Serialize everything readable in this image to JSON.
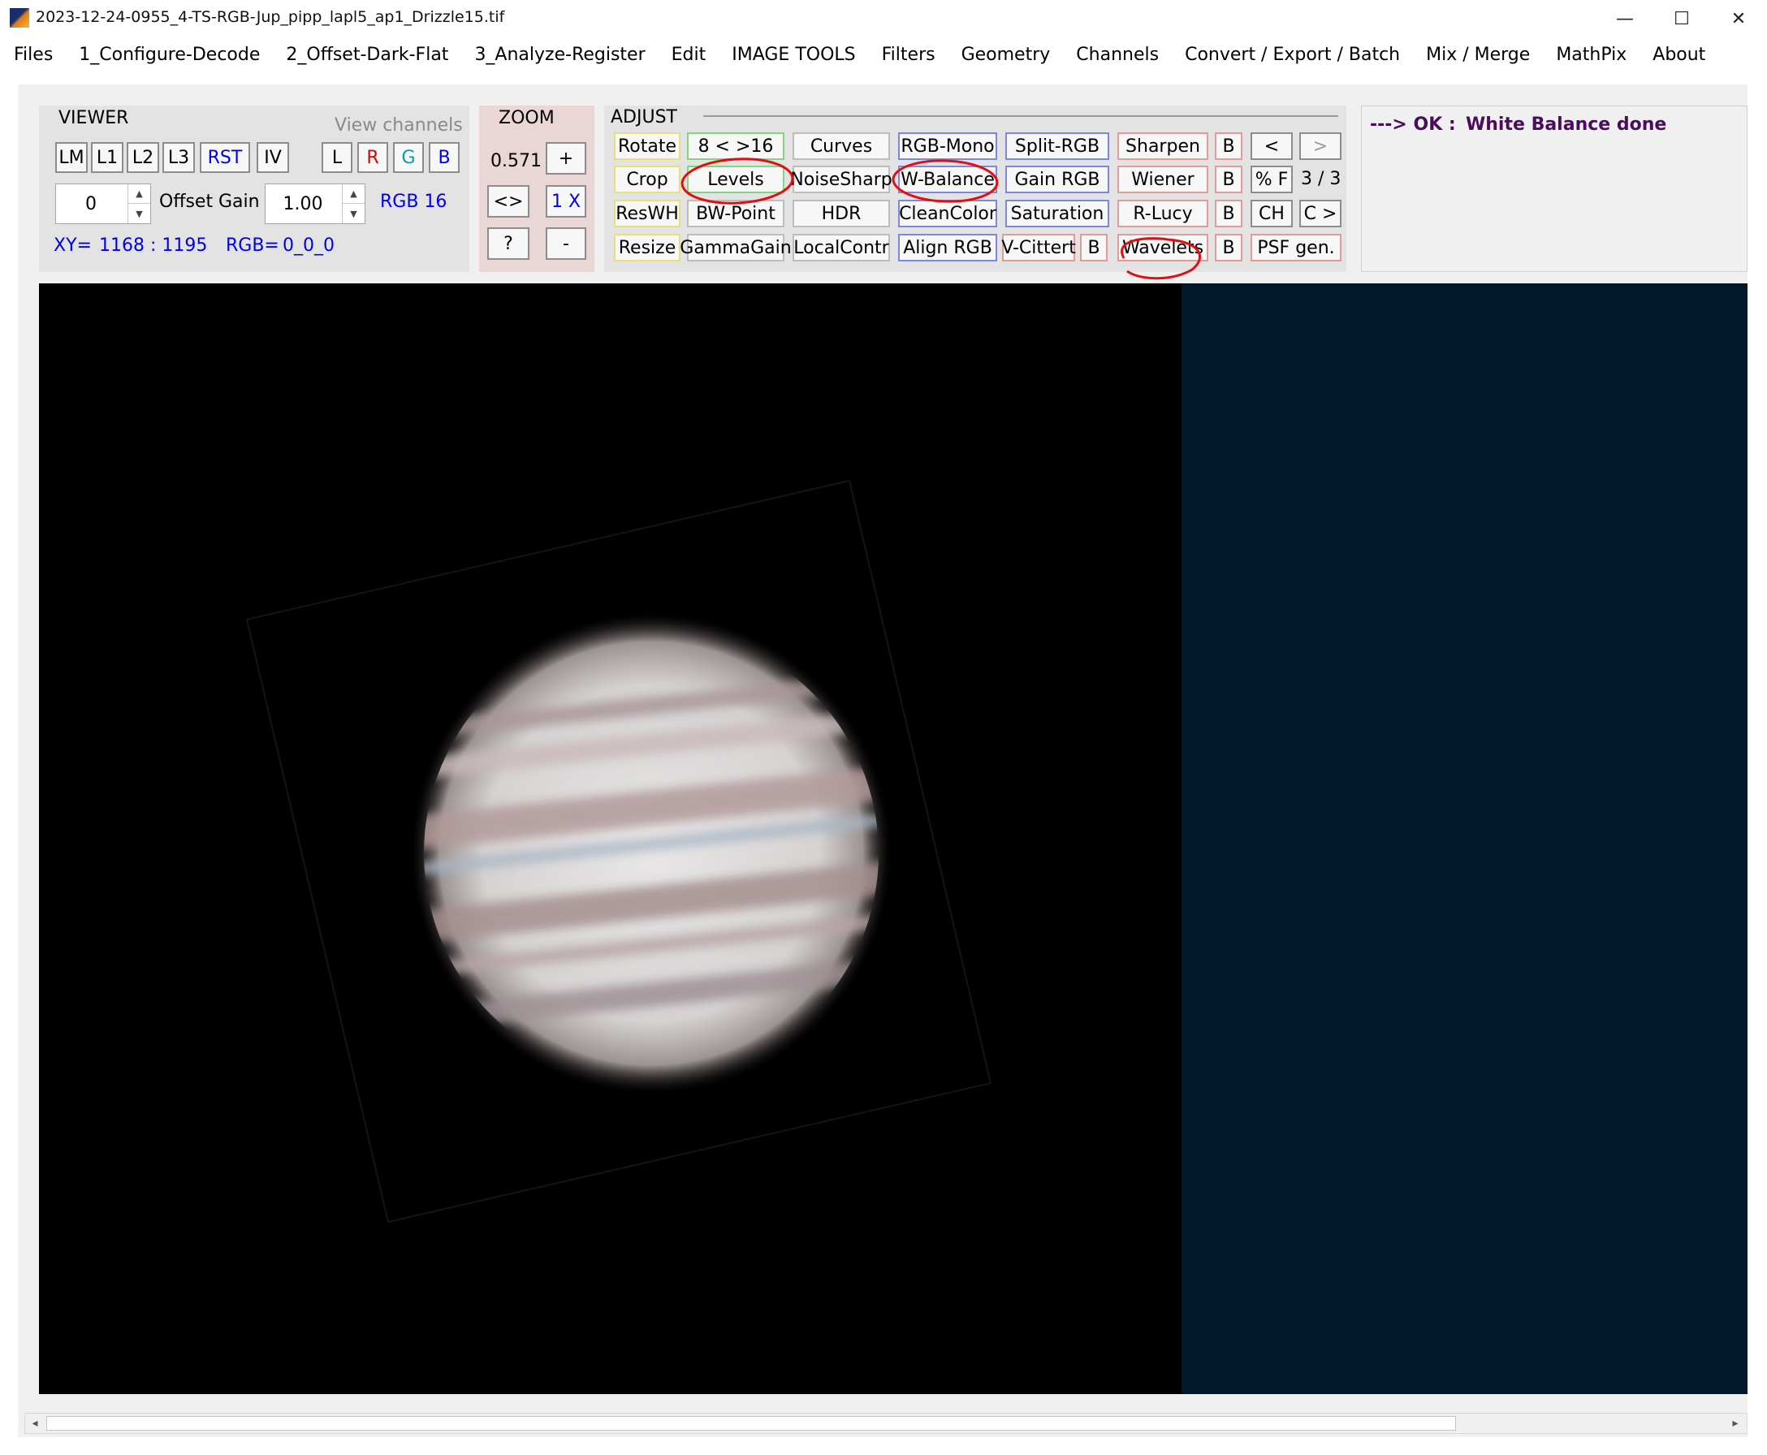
{
  "window": {
    "title": "2023-12-24-0955_4-TS-RGB-Jup_pipp_lapl5_ap1_Drizzle15.tif",
    "controls": [
      "—",
      "☐",
      "✕"
    ]
  },
  "menu": [
    "Files",
    "1_Configure-Decode",
    "2_Offset-Dark-Flat",
    "3_Analyze-Register",
    "Edit",
    "IMAGE TOOLS",
    "Filters",
    "Geometry",
    "Channels",
    "Convert / Export / Batch",
    "Mix / Merge",
    "MathPix",
    "About"
  ],
  "viewer": {
    "title": "VIEWER",
    "view_channels_label": "View channels",
    "buttons": [
      "LM",
      "L1",
      "L2",
      "L3",
      "RST",
      "IV"
    ],
    "channel_buttons": [
      "L",
      "R",
      "G",
      "B"
    ],
    "offset_value": "0",
    "offset_label": "Offset",
    "gain_label": "Gain",
    "gain_value": "1.00",
    "rgb_mode": "RGB 16",
    "xy_label": "XY=",
    "xy_value": "1168 : 1195",
    "rgb_label": "RGB=",
    "rgb_value": "0_0_0"
  },
  "zoom": {
    "title": "ZOOM",
    "value": "0.571",
    "plus": "+",
    "fit": "<>",
    "one_x": "1 X",
    "help": "?",
    "minus": "-"
  },
  "adjust": {
    "title": "ADJUST",
    "rows": [
      [
        "Rotate",
        "8 < >16",
        "Curves",
        "RGB-Mono",
        "Split-RGB",
        "Sharpen",
        "B",
        "<",
        ">"
      ],
      [
        "Crop",
        "Levels",
        "NoiseSharp",
        "W-Balance",
        "Gain RGB",
        "Wiener",
        "B",
        "% F",
        "3 / 3"
      ],
      [
        "ResWH",
        "BW-Point",
        "HDR",
        "CleanColor",
        "Saturation",
        "R-Lucy",
        "B",
        "CH",
        "C >"
      ],
      [
        "Resize",
        "GammaGain",
        "LocalContr",
        "Align RGB",
        "V-Cittert",
        "B",
        "Wavelets",
        "B",
        "PSF gen."
      ]
    ]
  },
  "status": {
    "prefix": "---> OK :",
    "message": "White Balance done"
  },
  "scrollbar": {
    "left_arrow": "◂",
    "right_arrow": "▸"
  },
  "colors": {
    "accent_blue": "#0000ee",
    "status_purple": "#4b0d5b",
    "annotation_red": "#e01010",
    "viewport_navy": "#01182b"
  }
}
